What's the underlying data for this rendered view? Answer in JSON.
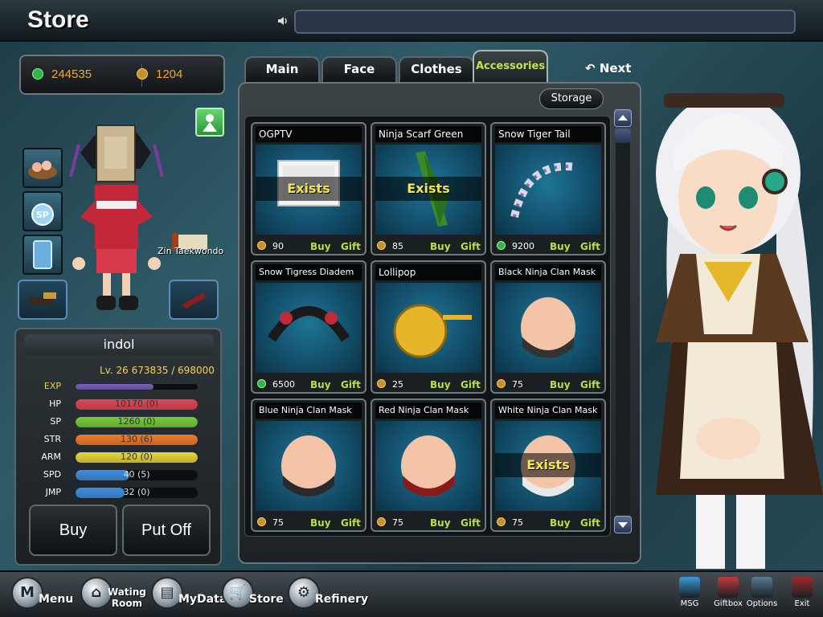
{
  "header": {
    "title": "Store"
  },
  "currency": {
    "cash": "244535",
    "coins": "1204"
  },
  "character": {
    "nameplate": "Zin Taekwondo"
  },
  "player": {
    "name": "indol",
    "level_text": "Lv. 26   673835 / 698000",
    "stats": [
      {
        "label": "EXP",
        "value": "",
        "fill": 0.64,
        "color": "#7b5fb8"
      },
      {
        "label": "HP",
        "value": "10170 (0)",
        "fill": 1.0,
        "color": "#e0485a"
      },
      {
        "label": "SP",
        "value": "1260 (0)",
        "fill": 1.0,
        "color": "#77cc3a"
      },
      {
        "label": "STR",
        "value": "130 (6)",
        "fill": 1.0,
        "color": "#f07a2a"
      },
      {
        "label": "ARM",
        "value": "120 (0)",
        "fill": 1.0,
        "color": "#e8d63a"
      },
      {
        "label": "SPD",
        "value": "40 (5)",
        "fill": 0.44,
        "color": "#3e8ee0"
      },
      {
        "label": "JMP",
        "value": "32 (0)",
        "fill": 0.4,
        "color": "#3e8ee0"
      }
    ]
  },
  "actions": {
    "buy": "Buy",
    "put_off": "Put Off"
  },
  "tabs": [
    "Main",
    "Face",
    "Clothes",
    "Accessories"
  ],
  "active_tab": "Accessories",
  "next_label": "Next",
  "storage_label": "Storage",
  "items": [
    {
      "name": "OGPTV",
      "price": "90",
      "currency": "coin",
      "exists": true
    },
    {
      "name": "Ninja Scarf Green",
      "price": "85",
      "currency": "coin",
      "exists": true
    },
    {
      "name": "Snow Tiger Tail",
      "price": "9200",
      "currency": "cash",
      "exists": false
    },
    {
      "name": "Snow Tigress Diadem",
      "price": "6500",
      "currency": "cash",
      "exists": false
    },
    {
      "name": "Lollipop",
      "price": "25",
      "currency": "coin",
      "exists": false
    },
    {
      "name": "Black Ninja Clan Mask",
      "price": "75",
      "currency": "coin",
      "exists": false
    },
    {
      "name": "Blue Ninja Clan Mask",
      "price": "75",
      "currency": "coin",
      "exists": false
    },
    {
      "name": "Red Ninja Clan Mask",
      "price": "75",
      "currency": "coin",
      "exists": false
    },
    {
      "name": "White Ninja Clan Mask",
      "price": "75",
      "currency": "coin",
      "exists": true
    }
  ],
  "item_labels": {
    "buy": "Buy",
    "gift": "Gift",
    "exists": "Exists"
  },
  "bottom_nav": [
    {
      "label": "Menu"
    },
    {
      "label": "Wating\nRoom"
    },
    {
      "label": "MyData"
    },
    {
      "label": "Store"
    },
    {
      "label": "Refinery"
    }
  ],
  "bottom_right": [
    {
      "label": "MSG"
    },
    {
      "label": "Giftbox"
    },
    {
      "label": "Options"
    },
    {
      "label": "Exit"
    }
  ]
}
